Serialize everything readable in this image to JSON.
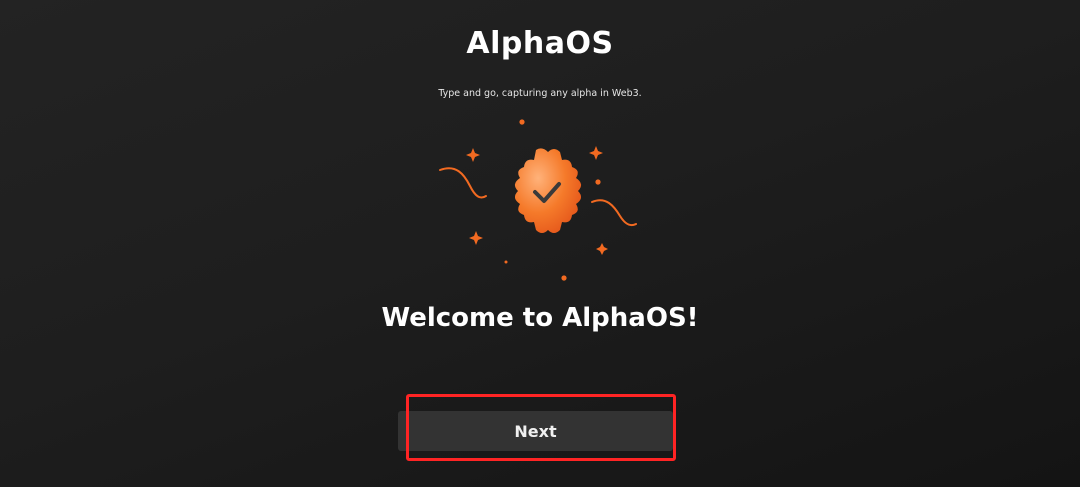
{
  "app": {
    "title": "AlphaOS",
    "tagline": "Type and go, capturing any alpha in Web3."
  },
  "illustration": {
    "icon": "verified-badge-check-icon",
    "accent_color": "#f26a21"
  },
  "main": {
    "welcome_text": "Welcome to AlphaOS!"
  },
  "actions": {
    "next_label": "Next",
    "highlight_color": "#ff2424"
  }
}
